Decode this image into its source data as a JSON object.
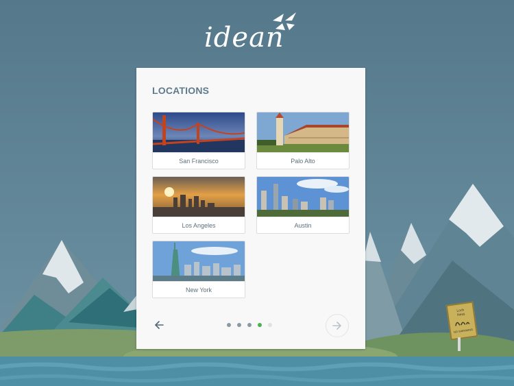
{
  "brand": {
    "name": "idean"
  },
  "colors": {
    "accent_dot": "#4caf50",
    "title": "#5e7a8b",
    "background": "#587f93"
  },
  "card": {
    "title": "LOCATIONS",
    "locations": [
      {
        "label": "San Francisco",
        "image": "golden-gate-bridge"
      },
      {
        "label": "Palo Alto",
        "image": "stanford-tower"
      },
      {
        "label": "Los Angeles",
        "image": "city-skyline-sunset"
      },
      {
        "label": "Austin",
        "image": "city-skyline-day"
      },
      {
        "label": "New York",
        "image": "statue-of-liberty"
      }
    ],
    "pagination": {
      "pages": 5,
      "current_page": 4
    },
    "prev_icon": "arrow-left-icon",
    "next_icon": "arrow-right-icon"
  },
  "sign": {
    "lines": [
      "Loch",
      "Ness"
    ],
    "footer": "NO SWIMMING"
  }
}
